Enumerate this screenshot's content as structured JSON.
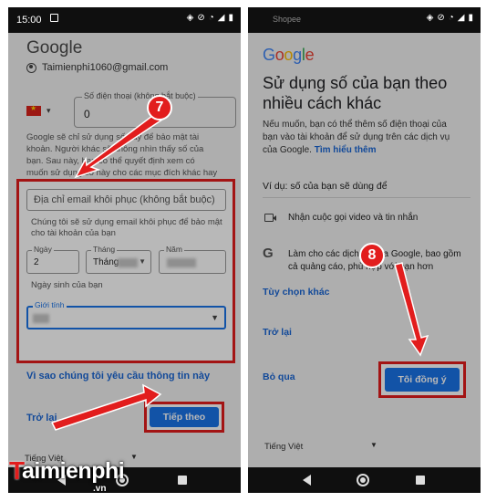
{
  "left_phone": {
    "status": {
      "time": "15:00"
    },
    "brand": "Google",
    "account_email": "Taimienphi1060@gmail.com",
    "phone_field": {
      "label": "Số điện thoại (không bắt buộc)",
      "value": "0"
    },
    "phone_help": "Google sẽ chỉ sử dụng số này để bảo mật tài khoản. Người khác sẽ không nhìn thấy số của bạn. Sau này, bạn có thể quyết định xem có muốn sử dụng số này cho các mục đích khác hay không",
    "recovery_email": {
      "placeholder": "Địa chỉ email khôi phục (không bắt buộc)"
    },
    "recovery_help": "Chúng tôi sẽ sử dụng email khôi phục để bảo mật cho tài khoản của bạn",
    "day": {
      "label": "Ngày",
      "value": "2"
    },
    "month": {
      "label": "Tháng",
      "value": "Tháng"
    },
    "year": {
      "label": "Năm"
    },
    "dob_help": "Ngày sinh của bạn",
    "gender": {
      "label": "Giới tính"
    },
    "why_link": "Vì sao chúng tôi yêu cầu thông tin này",
    "back_link": "Trở lại",
    "next_button": "Tiếp theo",
    "language": "Tiếng Việt",
    "step": "7"
  },
  "right_phone": {
    "status": {
      "carrier": "Shopee"
    },
    "brand_letters": [
      "G",
      "o",
      "o",
      "g",
      "l",
      "e"
    ],
    "heading": "Sử dụng số của bạn theo nhiều cách khác",
    "description": "Nếu muốn, bạn có thể thêm số điện thoại của bạn vào tài khoản để sử dụng trên các dịch vụ của Google.",
    "learn_more": "Tìm hiểu thêm",
    "example_heading": "Ví dụ: số của bạn sẽ dùng để",
    "feature_video": "Nhận cuộc gọi video và tin nhắn",
    "feature_ads": "Làm cho các dịch vụ của Google, bao gồm cả quảng cáo, phù hợp với bạn hơn",
    "more_options": "Tùy chọn khác",
    "back_link": "Trở lại",
    "skip_link": "Bỏ qua",
    "agree_button": "Tôi đồng ý",
    "language": "Tiếng Việt",
    "step": "8"
  },
  "watermark": {
    "brand": "aimienphi",
    "initial": "T",
    "suffix": ".vn"
  },
  "colors": {
    "accent_blue": "#1a73e8",
    "link_blue": "#1a66d4",
    "highlight_red": "#e21d1d"
  }
}
